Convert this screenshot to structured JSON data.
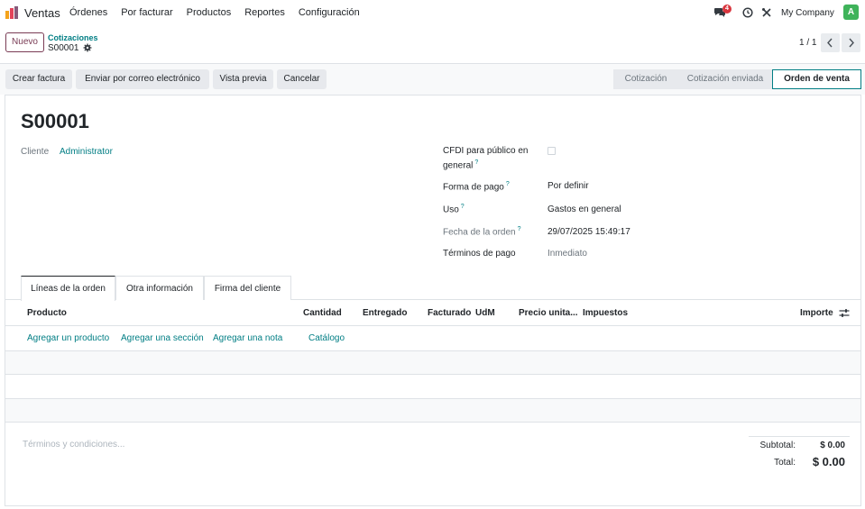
{
  "navbar": {
    "app_name": "Ventas",
    "menu": [
      "Órdenes",
      "Por facturar",
      "Productos",
      "Reportes",
      "Configuración"
    ],
    "chat_badge": "4",
    "company": "My Company",
    "avatar_letter": "A"
  },
  "control": {
    "new_label": "Nuevo",
    "breadcrumb": "Cotizaciones",
    "record": "S00001",
    "pager": "1 / 1"
  },
  "actions": {
    "buttons": [
      "Crear factura",
      "Enviar por correo electrónico",
      "Vista previa",
      "Cancelar"
    ],
    "stages": [
      "Cotización",
      "Cotización enviada",
      "Orden de venta"
    ],
    "active_stage": "Orden de venta"
  },
  "form": {
    "title": "S00001",
    "customer_label": "Cliente",
    "customer_value": "Administrator",
    "cfdi_label_1": "CFDI para público en",
    "cfdi_label_2": "general",
    "payment_form_label": "Forma de pago",
    "payment_form_value": "Por definir",
    "use_label": "Uso",
    "use_value": "Gastos en general",
    "order_date_label": "Fecha de la orden",
    "order_date_value": "29/07/2025 15:49:17",
    "payment_terms_label": "Términos de pago",
    "payment_terms_placeholder": "Inmediato",
    "help_mark": "?"
  },
  "tabs": [
    "Líneas de la orden",
    "Otra información",
    "Firma del cliente"
  ],
  "table": {
    "headers": {
      "product": "Producto",
      "qty": "Cantidad",
      "delivered": "Entregado",
      "invoiced": "Facturado",
      "uom": "UdM",
      "price": "Precio unita...",
      "taxes": "Impuestos",
      "amount": "Importe"
    },
    "add_links": [
      "Agregar un producto",
      "Agregar una sección",
      "Agregar una nota",
      "Catálogo"
    ]
  },
  "footer": {
    "terms_placeholder": "Términos y condiciones...",
    "subtotal_label": "Subtotal:",
    "subtotal_value": "$ 0.00",
    "total_label": "Total:",
    "total_value": "$ 0.00"
  },
  "colors": {
    "accent": "#017e84",
    "brand": "#7a3c55",
    "avatar": "#3fb35a",
    "badge": "#d9363e"
  }
}
